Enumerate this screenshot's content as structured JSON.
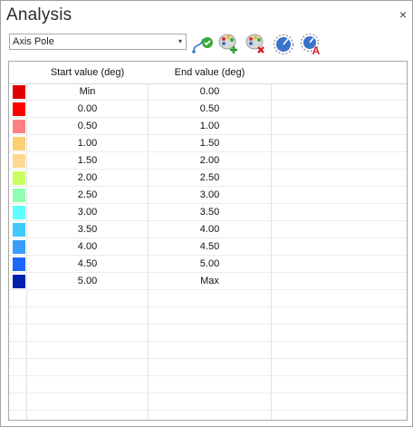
{
  "window": {
    "title": "Analysis",
    "close_glyph": "×"
  },
  "selector": {
    "value": "Axis Pole",
    "arrow": "▾"
  },
  "toolbar": [
    {
      "name": "apply-curve-icon"
    },
    {
      "name": "add-color-palette-icon"
    },
    {
      "name": "remove-color-palette-icon"
    },
    {
      "name": "range-dial-icon"
    },
    {
      "name": "range-dial-label-icon"
    }
  ],
  "table": {
    "headers": {
      "start": "Start value (deg)",
      "end": "End value (deg)"
    },
    "rows": [
      {
        "color": "#e00000",
        "start": "Min",
        "end": "0.00"
      },
      {
        "color": "#ff0000",
        "start": "0.00",
        "end": "0.50"
      },
      {
        "color": "#ff8080",
        "start": "0.50",
        "end": "1.00"
      },
      {
        "color": "#ffd070",
        "start": "1.00",
        "end": "1.50"
      },
      {
        "color": "#ffd890",
        "start": "1.50",
        "end": "2.00"
      },
      {
        "color": "#c8ff60",
        "start": "2.00",
        "end": "2.50"
      },
      {
        "color": "#90ffb0",
        "start": "2.50",
        "end": "3.00"
      },
      {
        "color": "#60ffff",
        "start": "3.00",
        "end": "3.50"
      },
      {
        "color": "#40c8ff",
        "start": "3.50",
        "end": "4.00"
      },
      {
        "color": "#3a9cff",
        "start": "4.00",
        "end": "4.50"
      },
      {
        "color": "#1a66ff",
        "start": "4.50",
        "end": "5.00"
      },
      {
        "color": "#0020b0",
        "start": "5.00",
        "end": "Max"
      }
    ],
    "empty_rows": 8
  }
}
